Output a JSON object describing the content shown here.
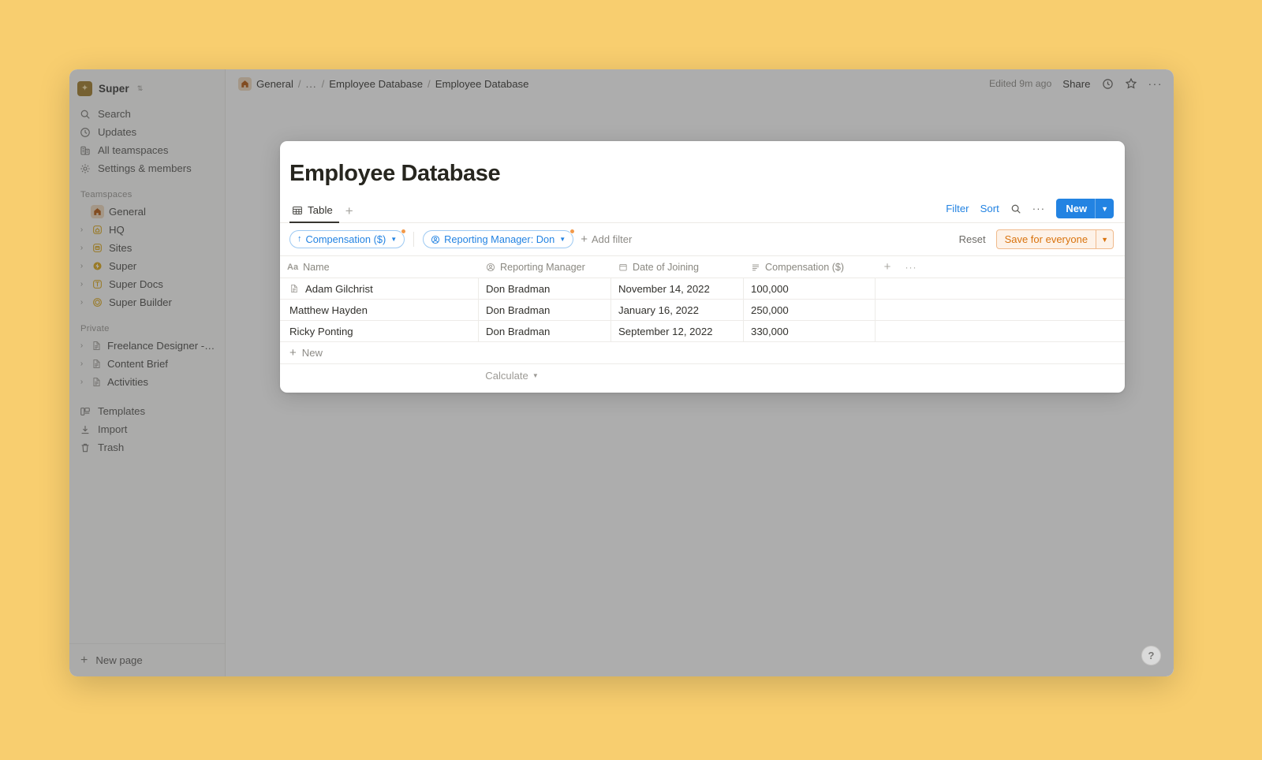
{
  "workspace": {
    "name": "Super",
    "logo_glyph": "✦",
    "switcher_icon": "chevron-updown-icon"
  },
  "sidebar": {
    "nav": [
      {
        "label": "Search",
        "icon": "search-icon"
      },
      {
        "label": "Updates",
        "icon": "clock-icon"
      },
      {
        "label": "All teamspaces",
        "icon": "building-icon"
      },
      {
        "label": "Settings & members",
        "icon": "gear-icon"
      }
    ],
    "teamspaces_label": "Teamspaces",
    "teamspaces": [
      {
        "label": "General",
        "icon": "home-icon",
        "expandable": false
      },
      {
        "label": "HQ",
        "icon": "house-outline-icon",
        "expandable": true
      },
      {
        "label": "Sites",
        "icon": "window-icon",
        "expandable": true
      },
      {
        "label": "Super",
        "icon": "bolt-icon",
        "expandable": true
      },
      {
        "label": "Super Docs",
        "icon": "layout-icon",
        "expandable": true
      },
      {
        "label": "Super Builder",
        "icon": "cube-icon",
        "expandable": true
      }
    ],
    "private_label": "Private",
    "private": [
      {
        "label": "Freelance Designer - Cli...",
        "icon": "document-icon"
      },
      {
        "label": "Content Brief",
        "icon": "document-icon"
      },
      {
        "label": "Activities",
        "icon": "document-icon"
      }
    ],
    "utilities": [
      {
        "label": "Templates",
        "icon": "templates-icon"
      },
      {
        "label": "Import",
        "icon": "import-icon"
      },
      {
        "label": "Trash",
        "icon": "trash-icon"
      }
    ],
    "new_page": {
      "label": "New page",
      "icon": "plus-icon"
    }
  },
  "topbar": {
    "breadcrumb": [
      {
        "label": "General",
        "icon": "home-icon"
      },
      {
        "label": "..."
      },
      {
        "label": "Employee Database"
      },
      {
        "label": "Employee Database"
      }
    ],
    "separator": "/",
    "edited": "Edited 9m ago",
    "share_label": "Share",
    "icons": [
      "clock-icon",
      "star-icon",
      "more-horizontal-icon"
    ]
  },
  "database": {
    "title": "Employee Database",
    "views": [
      {
        "label": "Table",
        "icon": "table-icon",
        "active": true
      }
    ],
    "add_view_label": "+",
    "toolbar": {
      "filter_label": "Filter",
      "sort_label": "Sort",
      "search_icon": "search-icon",
      "more_icon": "more-horizontal-icon",
      "new_label": "New",
      "new_chevron": "chevron-down-icon",
      "accent_color": "#2383e2"
    },
    "filters": {
      "chips": [
        {
          "label": "Compensation ($)",
          "icon": "arrow-up-icon",
          "has_badge": true
        },
        {
          "label": "Reporting Manager: Don",
          "icon": "person-icon",
          "has_badge": true
        }
      ],
      "add_filter_label": "Add filter",
      "reset_label": "Reset",
      "save_label": "Save for everyone",
      "save_color": "#d9730d",
      "badge_color": "#f2994a"
    },
    "columns": [
      {
        "label": "Name",
        "icon": "title-icon"
      },
      {
        "label": "Reporting Manager",
        "icon": "person-icon"
      },
      {
        "label": "Date of Joining",
        "icon": "calendar-icon"
      },
      {
        "label": "Compensation ($)",
        "icon": "text-icon"
      }
    ],
    "add_column_label": "+",
    "column_menu_label": "···",
    "rows": [
      {
        "name": "Adam Gilchrist",
        "reporting_manager": "Don Bradman",
        "date_of_joining": "November 14, 2022",
        "compensation": "100,000",
        "show_page_icon": true
      },
      {
        "name": "Matthew Hayden",
        "reporting_manager": "Don Bradman",
        "date_of_joining": "January 16, 2022",
        "compensation": "250,000",
        "show_page_icon": false
      },
      {
        "name": "Ricky Ponting",
        "reporting_manager": "Don Bradman",
        "date_of_joining": "September 12, 2022",
        "compensation": "330,000",
        "show_page_icon": false
      }
    ],
    "new_row_label": "New",
    "calculate_label": "Calculate"
  },
  "help": {
    "label": "?"
  },
  "theme": {
    "page_background": "#f8ce6f",
    "sidebar_background": "#fbfbfa",
    "accent_blue": "#2383e2",
    "accent_orange": "#d9730d"
  }
}
